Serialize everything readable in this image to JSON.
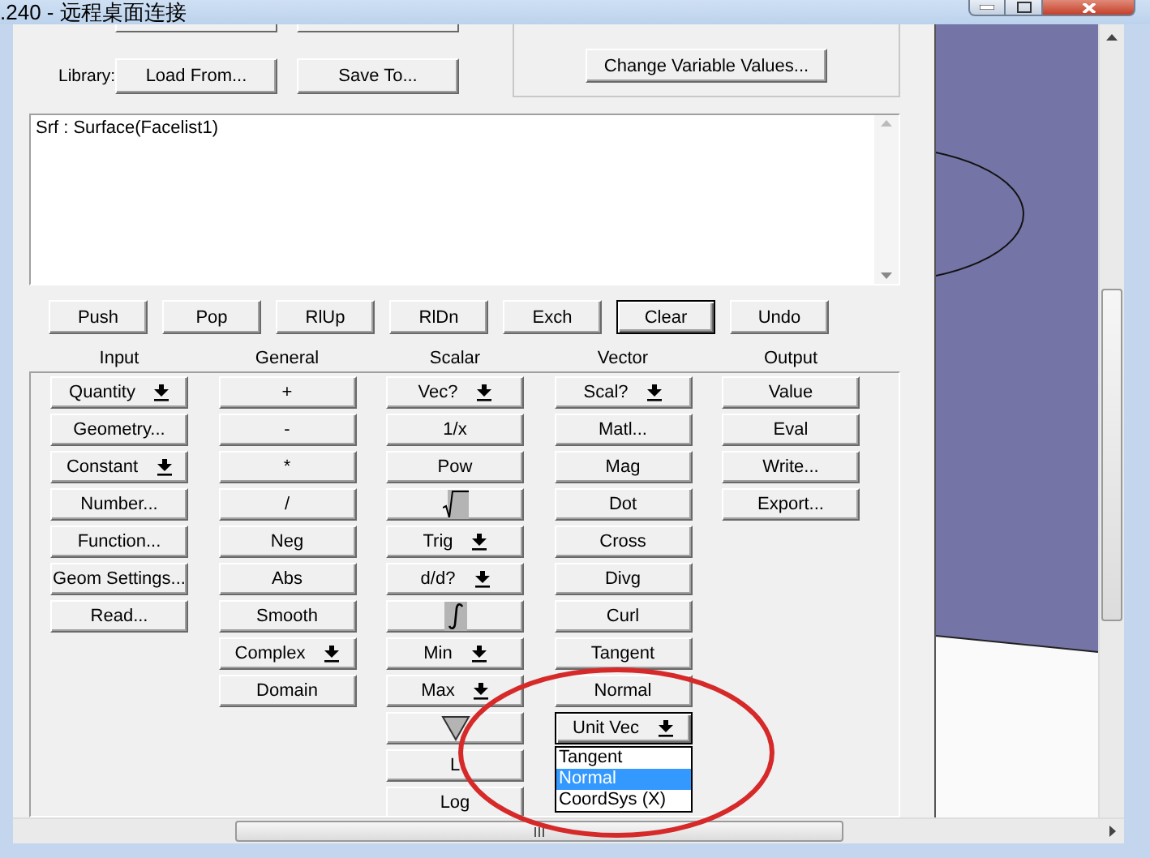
{
  "window": {
    "title": ".240 - 远程桌面连接"
  },
  "library": {
    "label": "Library:",
    "buttons": [
      "Load From...",
      "Save To..."
    ]
  },
  "variables_button": "Change Variable Values...",
  "expression_box": {
    "text": "Srf : Surface(Facelist1)"
  },
  "stack_buttons": [
    {
      "label": "Push",
      "focused": false
    },
    {
      "label": "Pop",
      "focused": false
    },
    {
      "label": "RlUp",
      "focused": false
    },
    {
      "label": "RlDn",
      "focused": false
    },
    {
      "label": "Exch",
      "focused": false
    },
    {
      "label": "Clear",
      "focused": true
    },
    {
      "label": "Undo",
      "focused": false
    }
  ],
  "columns": [
    {
      "heading": "Input",
      "buttons": [
        {
          "kind": "menu",
          "label": "Quantity"
        },
        {
          "kind": "plain",
          "label": "Geometry..."
        },
        {
          "kind": "menu",
          "label": "Constant"
        },
        {
          "kind": "plain",
          "label": "Number..."
        },
        {
          "kind": "plain",
          "label": "Function..."
        },
        {
          "kind": "plain",
          "label": "Geom Settings..."
        },
        {
          "kind": "plain",
          "label": "Read..."
        }
      ]
    },
    {
      "heading": "General",
      "buttons": [
        {
          "kind": "plain",
          "label": "+"
        },
        {
          "kind": "plain",
          "label": "-"
        },
        {
          "kind": "plain",
          "label": "*"
        },
        {
          "kind": "plain",
          "label": "/"
        },
        {
          "kind": "plain",
          "label": "Neg"
        },
        {
          "kind": "plain",
          "label": "Abs"
        },
        {
          "kind": "plain",
          "label": "Smooth"
        },
        {
          "kind": "menu",
          "label": "Complex"
        },
        {
          "kind": "plain",
          "label": "Domain"
        }
      ]
    },
    {
      "heading": "Scalar",
      "buttons": [
        {
          "kind": "menu",
          "label": "Vec?"
        },
        {
          "kind": "plain",
          "label": "1/x"
        },
        {
          "kind": "plain",
          "label": "Pow"
        },
        {
          "kind": "sqrt"
        },
        {
          "kind": "menu",
          "label": "Trig"
        },
        {
          "kind": "menu",
          "label": "d/d?"
        },
        {
          "kind": "integral"
        },
        {
          "kind": "menu",
          "label": "Min"
        },
        {
          "kind": "menu",
          "label": "Max"
        },
        {
          "kind": "triangle"
        },
        {
          "kind": "plain",
          "label": "L"
        },
        {
          "kind": "plain",
          "label": "Log"
        }
      ]
    },
    {
      "heading": "Vector",
      "buttons": [
        {
          "kind": "menu",
          "label": "Scal?",
          "focused": false
        },
        {
          "kind": "plain",
          "label": "Matl...",
          "focused": false
        },
        {
          "kind": "plain",
          "label": "Mag",
          "focused": false
        },
        {
          "kind": "plain",
          "label": "Dot",
          "focused": false
        },
        {
          "kind": "plain",
          "label": "Cross",
          "focused": false
        },
        {
          "kind": "plain",
          "label": "Divg",
          "focused": false
        },
        {
          "kind": "plain",
          "label": "Curl",
          "focused": false
        },
        {
          "kind": "plain",
          "label": "Tangent",
          "focused": false
        },
        {
          "kind": "plain",
          "label": "Normal",
          "focused": false
        },
        {
          "kind": "menu",
          "label": "Unit Vec",
          "focused": true
        }
      ],
      "dropdown_list": [
        {
          "label": "Tangent",
          "selected": false
        },
        {
          "label": "Normal",
          "selected": true
        },
        {
          "label": "CoordSys (X)",
          "selected": false
        }
      ]
    },
    {
      "heading": "Output",
      "buttons": [
        {
          "kind": "plain",
          "label": "Value"
        },
        {
          "kind": "plain",
          "label": "Eval"
        },
        {
          "kind": "plain",
          "label": "Write..."
        },
        {
          "kind": "plain",
          "label": "Export..."
        }
      ]
    }
  ]
}
